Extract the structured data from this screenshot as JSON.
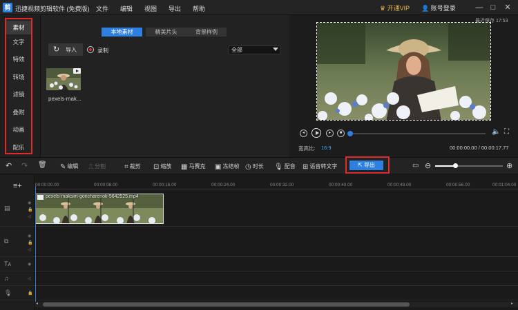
{
  "app": {
    "logo": "剪",
    "title": "迅捷视频剪辑软件 (免费版)",
    "menu": [
      "文件",
      "编辑",
      "视图",
      "导出",
      "帮助"
    ],
    "vip_label": "开通VIP",
    "login_label": "账号登录",
    "window_controls": [
      "—",
      "□",
      "✕"
    ]
  },
  "sidebar": {
    "items": [
      {
        "label": "素材",
        "active": true
      },
      {
        "label": "文字"
      },
      {
        "label": "特效"
      },
      {
        "label": "转场"
      },
      {
        "label": "滤镜"
      },
      {
        "label": "叠附"
      },
      {
        "label": "动画"
      },
      {
        "label": "配乐"
      }
    ]
  },
  "library": {
    "tabs": [
      "本地素材",
      "精美片头",
      "背景样例"
    ],
    "active_tab": 0,
    "import_label": "导入",
    "record_label": "录制",
    "filter_value": "全部",
    "media": [
      {
        "label": "pexels-mak..."
      }
    ]
  },
  "preview": {
    "status": "最近保存 17:53",
    "aspect_label": "宽高比:",
    "aspect_value": "16:9",
    "timecode": "00:00:00.00 / 00:00:17.77",
    "progress": 0.0
  },
  "toolbar": {
    "tools": [
      {
        "label": "编辑",
        "icon": "edit-icon"
      },
      {
        "label": "分割",
        "icon": "split-icon",
        "disabled": true
      },
      {
        "label": "裁剪",
        "icon": "crop-icon"
      },
      {
        "label": "缩放",
        "icon": "zoom-icon"
      },
      {
        "label": "马赛克",
        "icon": "mosaic-icon"
      },
      {
        "label": "冻结帧",
        "icon": "freeze-frame-icon"
      },
      {
        "label": "时长",
        "icon": "clock-icon"
      },
      {
        "label": "配音",
        "icon": "microphone-icon"
      },
      {
        "label": "语音转文字",
        "icon": "speech-to-text-icon"
      }
    ],
    "export_label": "导出",
    "zoom_level": 0.3
  },
  "timeline": {
    "ticks": [
      "00:00:00.00",
      "00:00:08.00",
      "00:00:16.00",
      "00:00:24.00",
      "00:00:32.00",
      "00:00:40.00",
      "00:00:48.00",
      "00:00:56.00",
      "00:01:04.00"
    ],
    "clip_label": "pexels-maksim-goncharenok-5642525.mp4"
  }
}
